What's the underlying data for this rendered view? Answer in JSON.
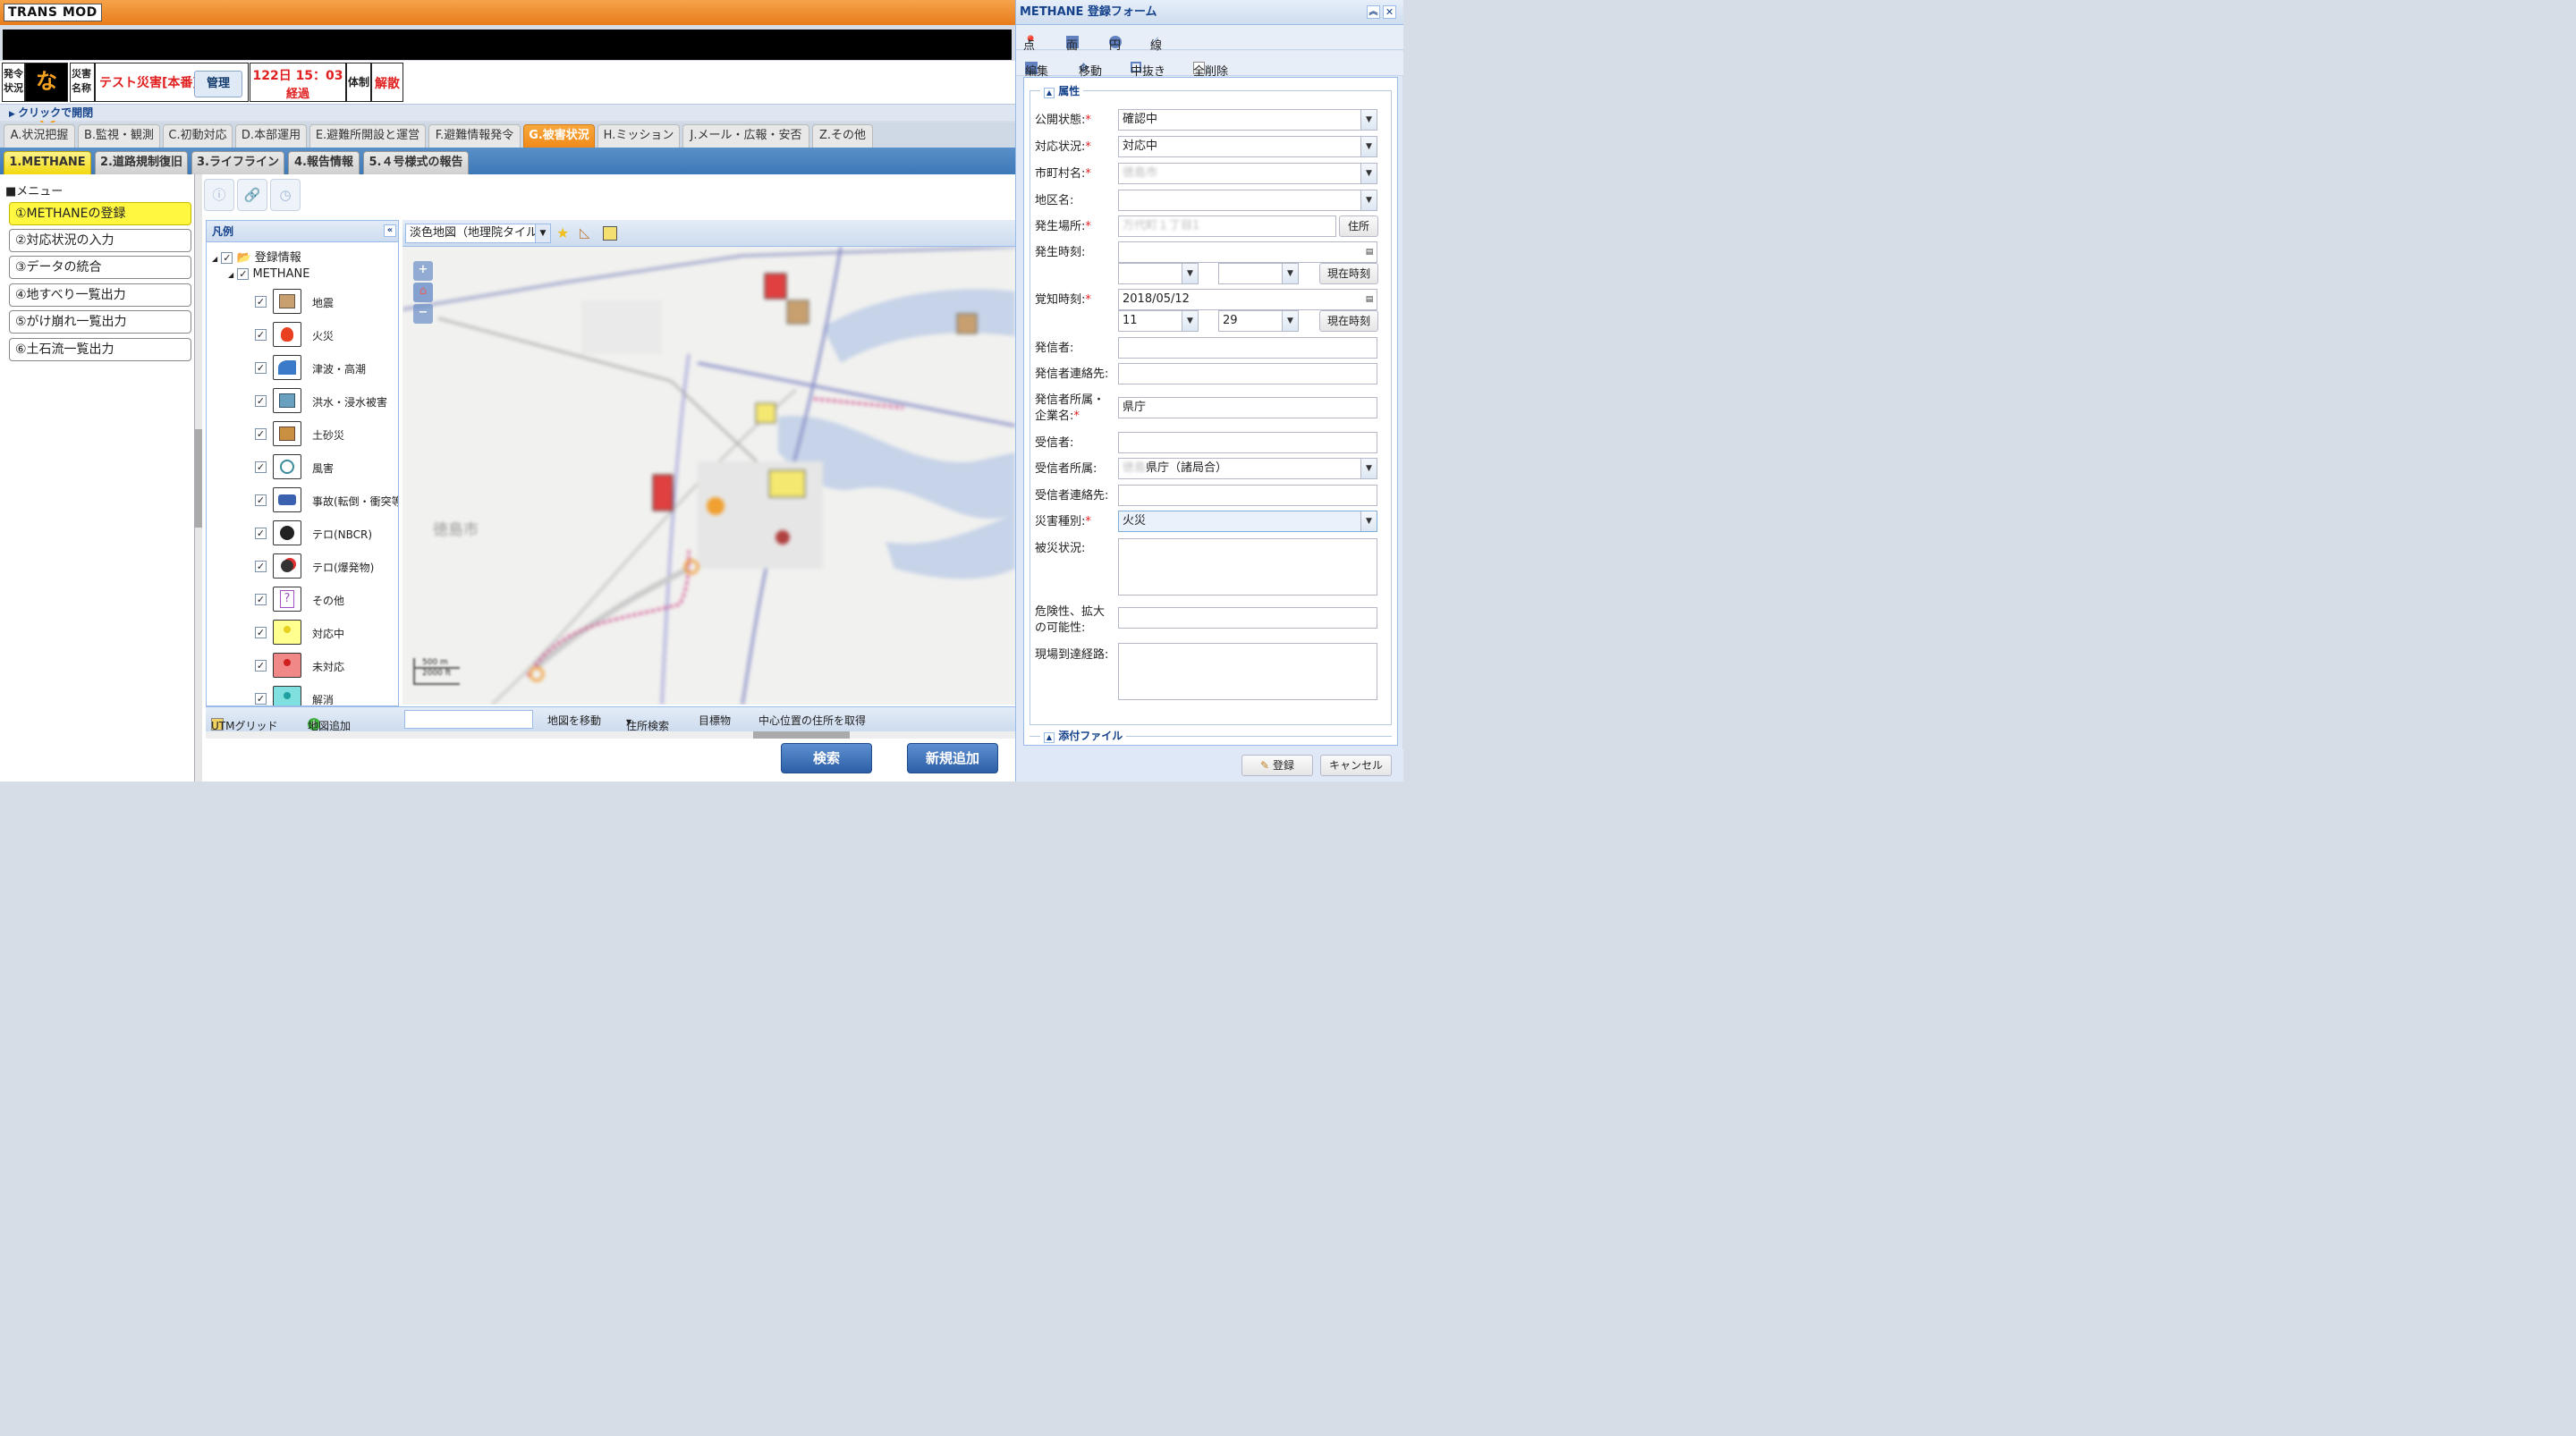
{
  "app": {
    "title": "TRANS MOD"
  },
  "status": {
    "hatsurei_label": "発令状況",
    "hatsurei_value": "なし",
    "saigai_label": "災害名称",
    "saigai_value": "テスト災害[本番]",
    "kanri_button": "管理",
    "elapsed_line1": "122日 15：03",
    "elapsed_line2": "経過",
    "taisei_label": "体制",
    "taisei_value": "解散"
  },
  "open_bar": "クリックで開閉",
  "main_tabs": [
    "A.状況把握",
    "B.監視・観測",
    "C.初動対応",
    "D.本部運用",
    "E.避難所開設と運営",
    "F.避難情報発令",
    "G.被害状況",
    "H.ミッション",
    "J.メール・広報・安否",
    "Z.その他"
  ],
  "sub_tabs": [
    "1.METHANE",
    "2.道路規制復旧",
    "3.ライフライン",
    "4.報告情報",
    "5.４号様式の報告"
  ],
  "menu": {
    "title": "■メニュー",
    "items": [
      "①METHANEの登録",
      "②対応状況の入力",
      "③データの統合",
      "④地すべり一覧出力",
      "⑤がけ崩れ一覧出力",
      "⑥土石流一覧出力"
    ]
  },
  "legend": {
    "title": "凡例",
    "root": "登録情報",
    "group": "METHANE",
    "items": [
      "地震",
      "火災",
      "津波・高潮",
      "洪水・浸水被害",
      "土砂災",
      "風害",
      "事故(転倒・衝突等",
      "テロ(NBCR)",
      "テロ(爆発物)",
      "その他",
      "対応中",
      "未対応",
      "解消"
    ],
    "utm_grid": "UTMグリッド",
    "add_map": "地図追加"
  },
  "map": {
    "layer_select": "淡色地図（地理院タイル",
    "move_map": "地図を移動",
    "address_search": "住所検索",
    "landmark": "目標物",
    "center_address": "中心位置の住所を取得",
    "city_label": "徳島市",
    "scale_m": "500 m",
    "scale_ft": "2000 ft"
  },
  "buttons": {
    "search": "検索",
    "add_new": "新規追加"
  },
  "form": {
    "title": "METHANE 登録フォーム",
    "tools1": [
      "点",
      "面",
      "円",
      "線"
    ],
    "tools2": [
      "編集",
      "移動",
      "中抜き",
      "全削除"
    ],
    "section_attr": "属性",
    "section_files": "添付ファイル",
    "labels": {
      "status": "公開状態:",
      "response": "対応状況:",
      "city": "市町村名:",
      "district": "地区名:",
      "place": "発生場所:",
      "time": "発生時刻:",
      "aware": "覚知時刻:",
      "sender": "発信者:",
      "sender_contact": "発信者連絡先:",
      "sender_org1": "発信者所属・",
      "sender_org2": "企業名:",
      "receiver": "受信者:",
      "receiver_org": "受信者所属:",
      "receiver_contact": "受信者連絡先:",
      "disaster_type": "災害種別:",
      "damage": "被災状況:",
      "risk1": "危険性、拡大",
      "risk2": "の可能性:",
      "route": "現場到達経路:"
    },
    "values": {
      "status": "確認中",
      "response": "対応中",
      "city": "徳島市",
      "district": "",
      "place": "万代町１丁目1",
      "aware_date": "2018/05/12",
      "aware_hour": "11",
      "aware_min": "29",
      "sender_org": "県庁",
      "receiver_org_prefix": "徳島",
      "receiver_org": "県庁（諸局合）",
      "disaster_type": "火災"
    },
    "address_button": "住所",
    "now_button": "現在時刻",
    "submit": "登録",
    "cancel": "キャンセル"
  },
  "colors": {
    "orange": "#f08a18",
    "accent_blue": "#15428b",
    "required": "#e02020"
  }
}
